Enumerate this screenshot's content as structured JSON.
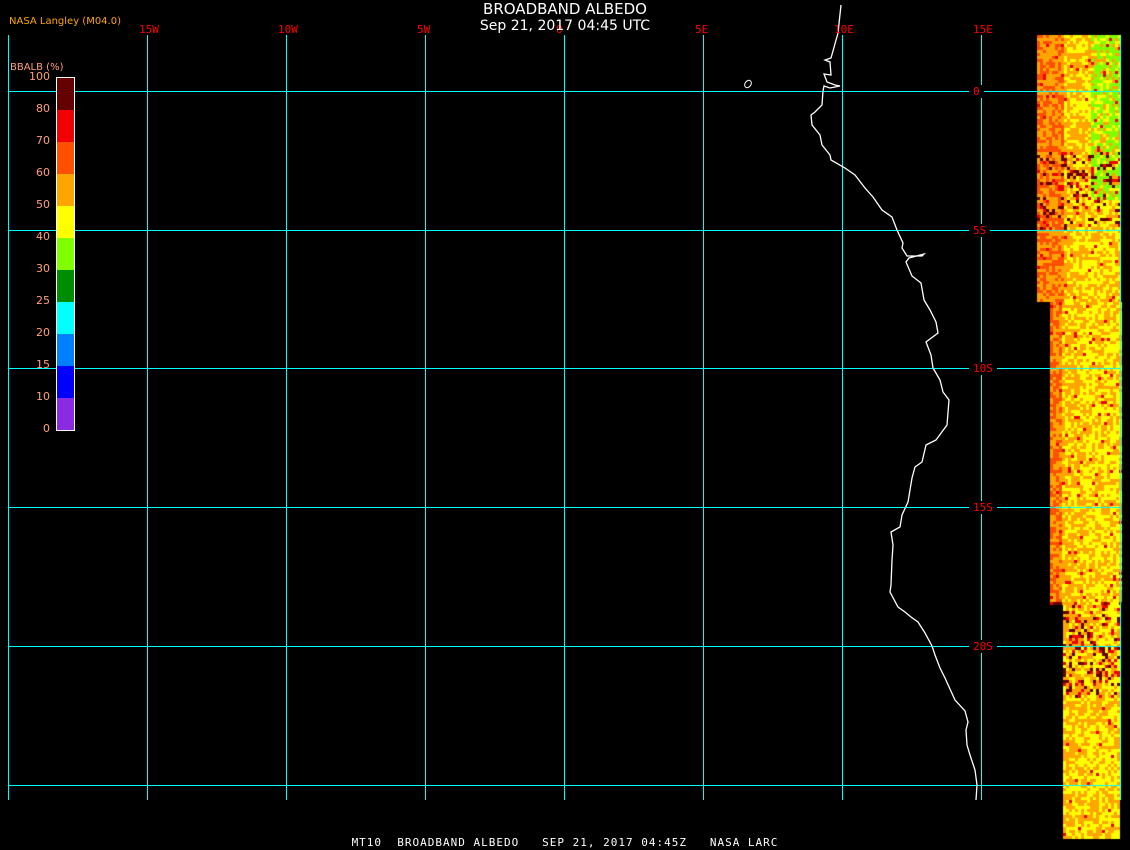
{
  "header": {
    "title": "BROADBAND ALBEDO",
    "datetime": "Sep 21, 2017 04:45 UTC",
    "credit": "NASA Langley (M04.0)"
  },
  "map": {
    "longitude_labels": [
      "15W",
      "10W",
      "5W",
      "0",
      "5E",
      "10E",
      "15E"
    ],
    "latitude_labels": [
      "0",
      "5S",
      "10S",
      "15S",
      "20S"
    ],
    "grid_color": "#00ffff",
    "label_color": "#ff0000",
    "coastline_color": "#ffffff"
  },
  "legend": {
    "title": "BBALB (%)",
    "ticks": [
      "100",
      "80",
      "70",
      "60",
      "50",
      "40",
      "30",
      "25",
      "20",
      "15",
      "10",
      "0"
    ],
    "colors": [
      "#640000",
      "#f00000",
      "#ff5000",
      "#ffa500",
      "#ffff00",
      "#80ff00",
      "#008c00",
      "#00ffff",
      "#0080ff",
      "#0000ff",
      "#8a2be2"
    ]
  },
  "footer": {
    "text": "MT10  BROADBAND ALBEDO   SEP 21, 2017 04:45Z   NASA LARC"
  }
}
